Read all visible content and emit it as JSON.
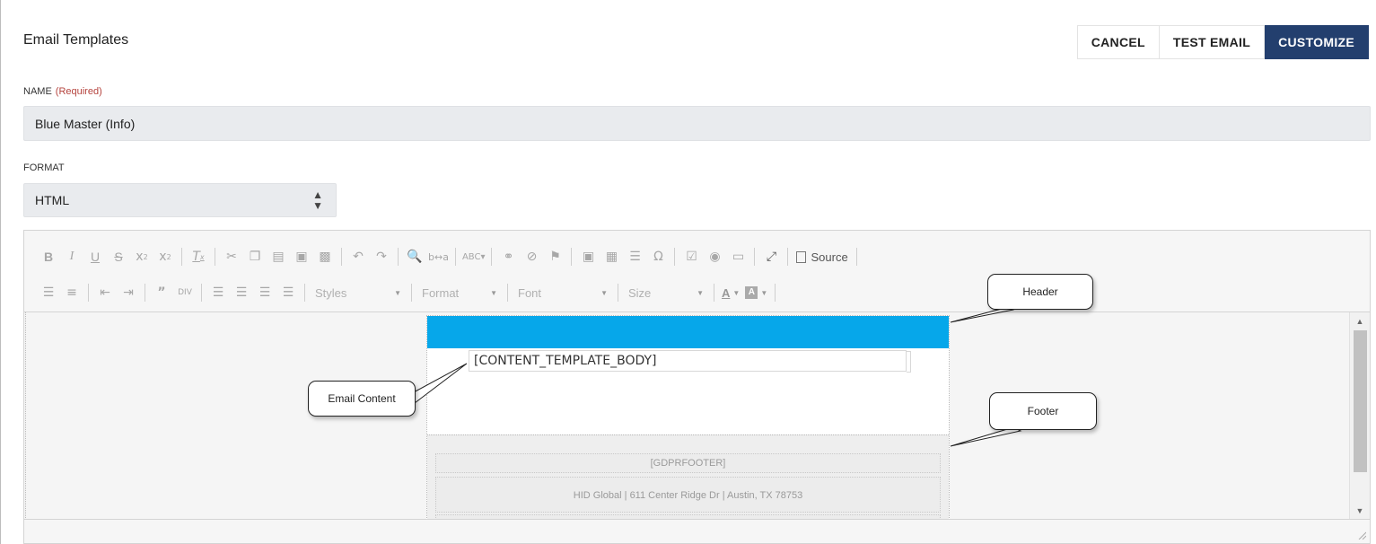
{
  "header": {
    "title": "Email Templates",
    "buttons": {
      "cancel": "CANCEL",
      "test_email": "TEST EMAIL",
      "customize": "CUSTOMIZE"
    }
  },
  "form": {
    "name_label": "NAME",
    "name_required": "(Required)",
    "name_value": "Blue Master (Info)",
    "format_label": "FORMAT",
    "format_value": "HTML"
  },
  "toolbar": {
    "source_label": "Source",
    "combos": {
      "styles": "Styles",
      "format": "Format",
      "font": "Font",
      "size": "Size"
    },
    "text_color_glyph": "A",
    "bg_color_glyph": "A"
  },
  "email": {
    "body_placeholder": "[CONTENT_TEMPLATE_BODY]",
    "footer_gdpr": "[GDPRFOOTER]",
    "footer_address": "HID Global | 611 Center Ridge Dr | Austin, TX 78753",
    "header_color": "#06a7ea"
  },
  "annotations": {
    "header": "Header",
    "email_content": "Email Content",
    "footer": "Footer"
  },
  "colors": {
    "primary_button": "#233f6e",
    "required": "#b5433d"
  }
}
